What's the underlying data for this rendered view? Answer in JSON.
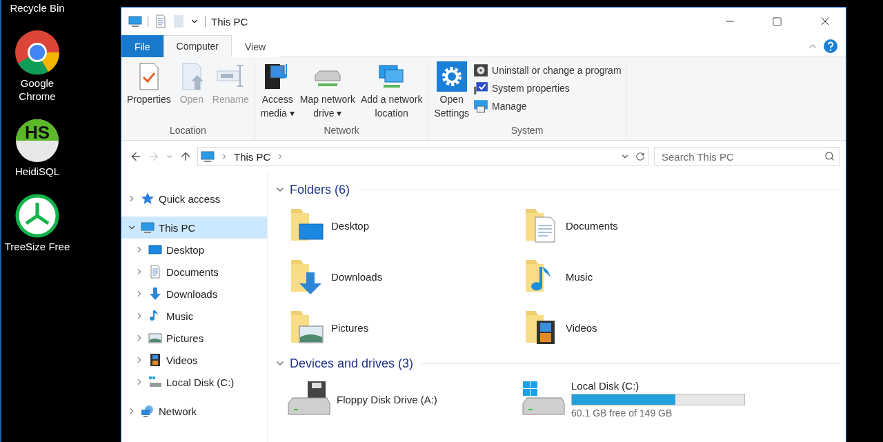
{
  "desktop_icons": [
    {
      "label": "Recycle Bin",
      "kind": "recycle"
    },
    {
      "label": "Google Chrome",
      "kind": "chrome"
    },
    {
      "label": "HeidiSQL",
      "kind": "heidi",
      "badge": "HS"
    },
    {
      "label": "TreeSize Free",
      "kind": "treesize"
    }
  ],
  "window": {
    "title": "This PC"
  },
  "ribbon_tabs": [
    {
      "label": "File",
      "kind": "file",
      "selected": false
    },
    {
      "label": "Computer",
      "kind": "tab",
      "selected": true
    },
    {
      "label": "View",
      "kind": "tab",
      "selected": false
    }
  ],
  "ribbon_groups": [
    {
      "label": "Location",
      "buttons": [
        {
          "lines": [
            "Properties"
          ],
          "kind": "properties",
          "disabled": false
        },
        {
          "lines": [
            "Open"
          ],
          "kind": "open",
          "disabled": true
        },
        {
          "lines": [
            "Rename"
          ],
          "kind": "rename",
          "disabled": true
        }
      ]
    },
    {
      "label": "Network",
      "buttons": [
        {
          "lines": [
            "Access",
            "media"
          ],
          "kind": "media",
          "disabled": false,
          "caret": "▾"
        },
        {
          "lines": [
            "Map network",
            "drive"
          ],
          "kind": "netdrive",
          "disabled": false,
          "caret": "▾"
        },
        {
          "lines": [
            "Add a network",
            "location"
          ],
          "kind": "netloc",
          "disabled": false
        }
      ]
    },
    {
      "label": "System",
      "buttons": [
        {
          "lines": [
            "Open",
            "Settings"
          ],
          "kind": "gear",
          "disabled": false
        }
      ],
      "small_buttons": [
        {
          "label": "Uninstall or change a program",
          "kind": "uninstall"
        },
        {
          "label": "System properties",
          "kind": "sysprops"
        },
        {
          "label": "Manage",
          "kind": "manage"
        }
      ]
    }
  ],
  "address": {
    "path": [
      "This PC"
    ]
  },
  "search": {
    "placeholder": "Search This PC"
  },
  "nav_tree": [
    {
      "label": "Quick access",
      "kind": "star",
      "expanded": false,
      "selected": false
    },
    {
      "label": "This PC",
      "kind": "pc",
      "expanded": true,
      "selected": true,
      "children": [
        {
          "label": "Desktop",
          "kind": "desktop",
          "expanded": false,
          "selected": false
        },
        {
          "label": "Documents",
          "kind": "documents",
          "expanded": false,
          "selected": false
        },
        {
          "label": "Downloads",
          "kind": "downloads",
          "expanded": false,
          "selected": false
        },
        {
          "label": "Music",
          "kind": "music",
          "expanded": false,
          "selected": false
        },
        {
          "label": "Pictures",
          "kind": "pictures",
          "expanded": false,
          "selected": false
        },
        {
          "label": "Videos",
          "kind": "videos",
          "expanded": false,
          "selected": false
        },
        {
          "label": "Local Disk (C:)",
          "kind": "disk",
          "expanded": false,
          "selected": false
        }
      ]
    },
    {
      "label": "Network",
      "kind": "network",
      "expanded": false,
      "selected": false
    }
  ],
  "sections": [
    {
      "title": "Folders (6)",
      "expanded": true,
      "items": [
        {
          "label": "Desktop",
          "kind": "desktop"
        },
        {
          "label": "Documents",
          "kind": "documents"
        },
        {
          "label": "Downloads",
          "kind": "downloads"
        },
        {
          "label": "Music",
          "kind": "music"
        },
        {
          "label": "Pictures",
          "kind": "pictures"
        },
        {
          "label": "Videos",
          "kind": "videos"
        }
      ]
    },
    {
      "title": "Devices and drives (3)",
      "expanded": true,
      "items": [
        {
          "label": "Floppy Disk Drive (A:)",
          "kind": "floppy"
        },
        {
          "label": "Local Disk (C:)",
          "kind": "disk",
          "level": 0.6,
          "detail": "60.1 GB free of 149 GB"
        }
      ]
    }
  ]
}
